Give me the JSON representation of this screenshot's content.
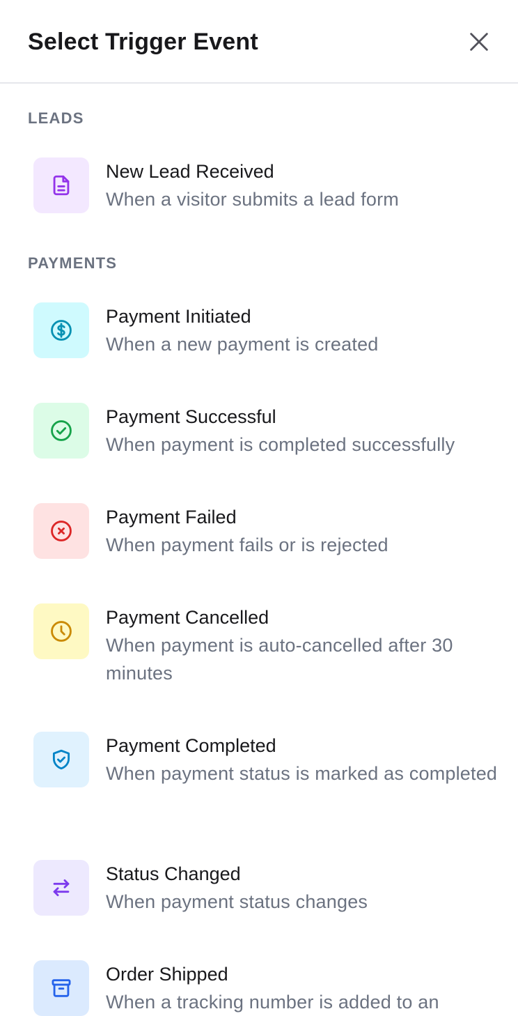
{
  "header": {
    "title": "Select Trigger Event",
    "close_icon": "close-icon"
  },
  "sections": {
    "leads": {
      "label": "LEADS",
      "items": [
        {
          "title": "New Lead Received",
          "description": "When a visitor submits a lead form",
          "icon": "document-icon",
          "icon_bg": "#f3e8ff",
          "icon_color": "#9333ea"
        }
      ]
    },
    "payments": {
      "label": "PAYMENTS",
      "items": [
        {
          "title": "Payment Initiated",
          "description": "When a new payment is created",
          "icon": "dollar-circle-icon",
          "icon_bg": "#cffafe",
          "icon_color": "#0891b2"
        },
        {
          "title": "Payment Successful",
          "description": "When payment is completed successfully",
          "icon": "check-circle-icon",
          "icon_bg": "#dcfce7",
          "icon_color": "#16a34a"
        },
        {
          "title": "Payment Failed",
          "description": "When payment fails or is rejected",
          "icon": "x-circle-icon",
          "icon_bg": "#fee2e2",
          "icon_color": "#dc2626"
        },
        {
          "title": "Payment Cancelled",
          "description": "When payment is auto-cancelled after 30 minutes",
          "icon": "clock-icon",
          "icon_bg": "#fef9c3",
          "icon_color": "#ca8a04"
        },
        {
          "title": "Payment Completed",
          "description": "When payment status is marked as completed",
          "icon": "shield-check-icon",
          "icon_bg": "#e0f2fe",
          "icon_color": "#0284c7"
        },
        {
          "title": "Status Changed",
          "description": "When payment status changes",
          "icon": "arrows-swap-icon",
          "icon_bg": "#ede9fe",
          "icon_color": "#7c3aed"
        },
        {
          "title": "Order Shipped",
          "description": "When a tracking number is added to an",
          "icon": "archive-box-icon",
          "icon_bg": "#dbeafe",
          "icon_color": "#2563eb"
        }
      ]
    }
  }
}
